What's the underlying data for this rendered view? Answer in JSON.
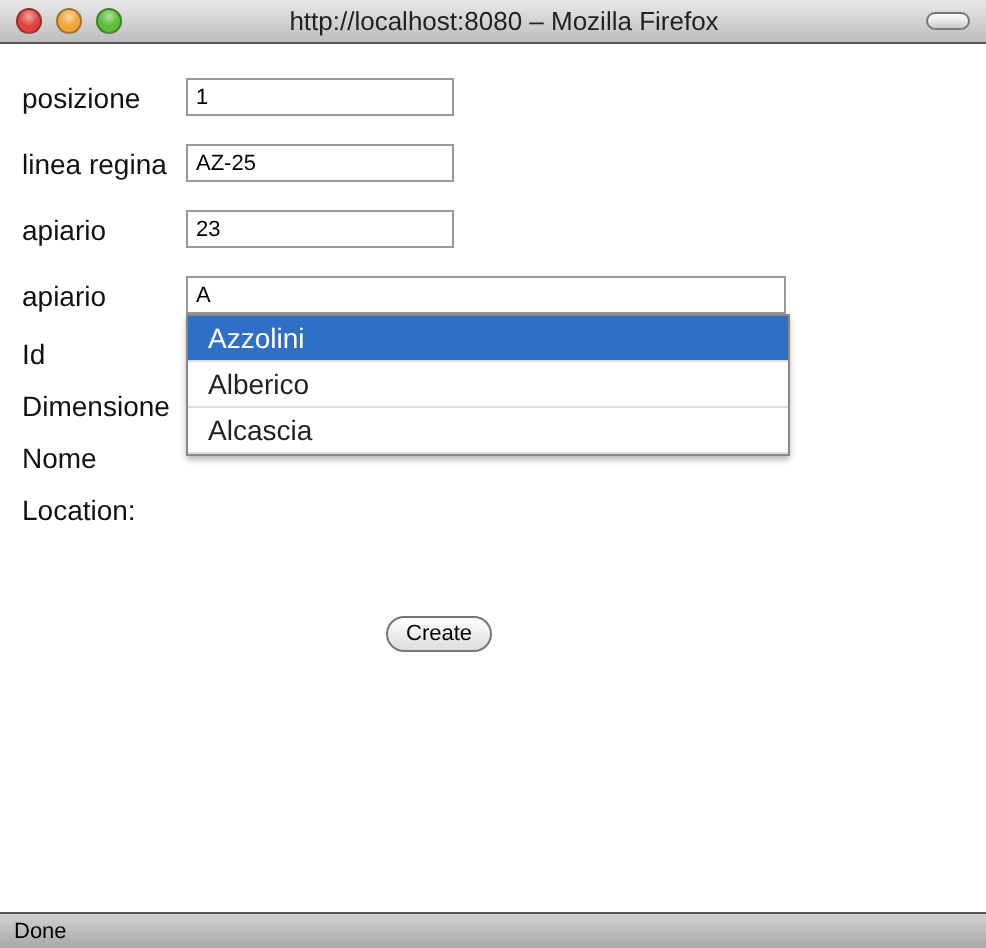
{
  "window": {
    "title": "http://localhost:8080 – Mozilla Firefox"
  },
  "fields": [
    {
      "label": "posizione",
      "value": "1",
      "kind": "short"
    },
    {
      "label": "linea regina",
      "value": "AZ-25",
      "kind": "short"
    },
    {
      "label": "apiario",
      "value": "23",
      "kind": "short"
    },
    {
      "label": "apiario",
      "value": "A",
      "kind": "wide"
    }
  ],
  "suggestions": [
    {
      "label": "Azzolini",
      "selected": true
    },
    {
      "label": "Alberico",
      "selected": false
    },
    {
      "label": "Alcascia",
      "selected": false
    }
  ],
  "labels": [
    "Id",
    "Dimensione",
    "Nome",
    "Location:"
  ],
  "button": "Create",
  "status_bar": "Done"
}
